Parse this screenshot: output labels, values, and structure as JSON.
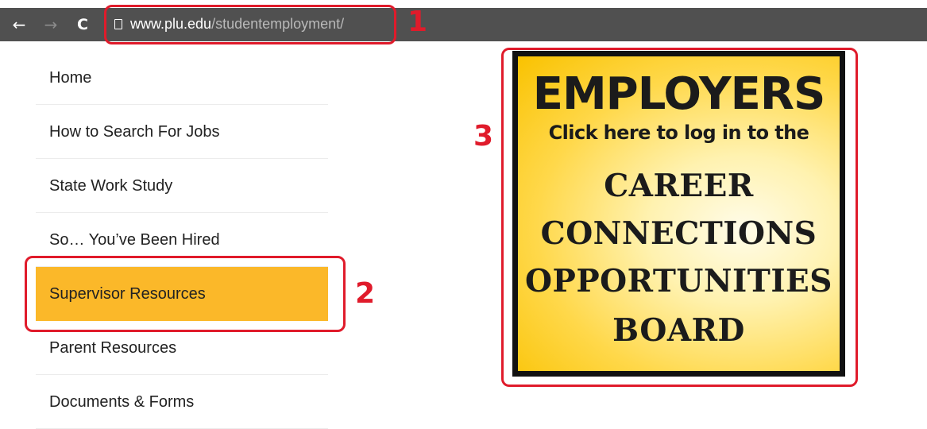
{
  "browser": {
    "url_host": "www.plu.edu",
    "url_path": "/studentemployment/",
    "back_glyph": "←",
    "forward_glyph": "→",
    "reload_glyph": "C"
  },
  "annotations": {
    "one": "1",
    "two": "2",
    "three": "3",
    "color": "#e01b2b"
  },
  "menu": {
    "items": [
      {
        "label": "Home"
      },
      {
        "label": "How to Search For Jobs"
      },
      {
        "label": "State Work Study"
      },
      {
        "label": "So… You’ve Been Hired"
      },
      {
        "label": "Supervisor Resources",
        "active": true
      },
      {
        "label": "Parent Resources"
      },
      {
        "label": "Documents & Forms"
      }
    ],
    "active_color": "#fbb829"
  },
  "banner": {
    "title": "EMPLOYERS",
    "subtitle": "Click here to log in to the",
    "lines": [
      "CAREER",
      "CONNECTIONS",
      "OPPORTUNITIES",
      "BOARD"
    ]
  }
}
